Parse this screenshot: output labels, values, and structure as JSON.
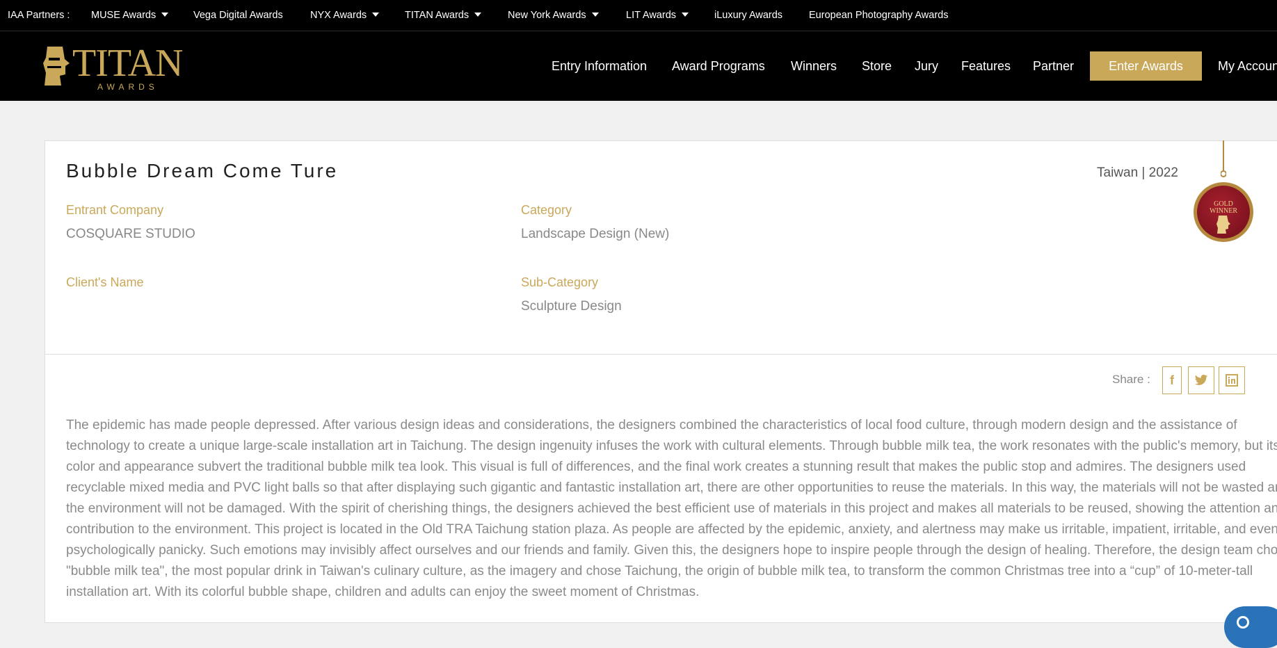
{
  "partner_bar": {
    "label": "IAA Partners :",
    "items": [
      {
        "label": "MUSE Awards",
        "dropdown": true
      },
      {
        "label": "Vega Digital Awards",
        "dropdown": false
      },
      {
        "label": "NYX Awards",
        "dropdown": true
      },
      {
        "label": "TITAN Awards",
        "dropdown": true
      },
      {
        "label": "New York Awards",
        "dropdown": true
      },
      {
        "label": "LIT Awards",
        "dropdown": true
      },
      {
        "label": "iLuxury Awards",
        "dropdown": false
      },
      {
        "label": "European Photography Awards",
        "dropdown": false
      }
    ]
  },
  "header": {
    "logo_main": "TITAN",
    "logo_sub": "AWARDS",
    "nav": [
      "Entry Information",
      "Award Programs",
      "Winners",
      "Store",
      "Jury",
      "Features",
      "Partner"
    ],
    "enter_button": "Enter Awards",
    "account": "My Account"
  },
  "entry": {
    "title": "Bubble Dream Come Ture",
    "country_year": "Taiwan | 2022",
    "fields": {
      "entrant_company": {
        "label": "Entrant Company",
        "value": "COSQUARE STUDIO"
      },
      "category": {
        "label": "Category",
        "value": "Landscape Design (New)"
      },
      "client_name": {
        "label": "Client's Name",
        "value": ""
      },
      "sub_category": {
        "label": "Sub-Category",
        "value": "Sculpture Design"
      }
    },
    "medal": {
      "line1": "GOLD",
      "line2": "WINNER"
    },
    "share": {
      "label": "Share :",
      "buttons": [
        {
          "icon": "facebook-icon",
          "glyph": "f"
        },
        {
          "icon": "twitter-icon",
          "glyph": "🐦"
        },
        {
          "icon": "linkedin-icon",
          "glyph": "in"
        }
      ]
    },
    "description": "The epidemic has made people depressed. After various design ideas and considerations, the designers combined the characteristics of local food culture, through modern design and the assistance of technology to create a unique large-scale installation art in Taichung. The design ingenuity infuses the work with cultural elements. Through bubble milk tea, the work resonates with the public's memory, but its color and appearance subvert the traditional bubble milk tea look. This visual is full of differences, and the final work creates a stunning result that makes the public stop and admires. The designers used recyclable mixed media and PVC light balls so that after displaying such gigantic and fantastic installation art, there are other opportunities to reuse the materials. In this way, the materials will not be wasted and the environment will not be damaged. With the spirit of cherishing things, the designers achieved the best efficient use of materials in this project and makes all materials to be reused, showing the attention and contribution to the environment. This project is located in the Old TRA Taichung station plaza. As people are affected by the epidemic, anxiety, and alertness may make us irritable, impatient, irritable, and even psychologically panicky. Such emotions may invisibly affect ourselves and our friends and family. Given this, the designers hope to inspire people through the design of healing. Therefore, the design team chose \"bubble milk tea\", the most popular drink in Taiwan's culinary culture, as the imagery and chose Taichung, the origin of bubble milk tea, to transform the common Christmas tree into a “cup” of 10-meter-tall installation art. With its colorful bubble shape, children and adults can enjoy the sweet moment of Christmas."
  },
  "colors": {
    "gold": "#c9a85a",
    "black": "#000000",
    "medal_red": "#8b1422",
    "chat_blue": "#2a73b8"
  }
}
